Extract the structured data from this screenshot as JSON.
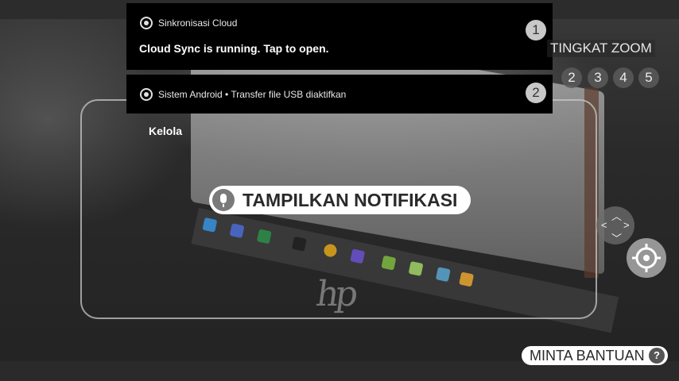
{
  "notifications": [
    {
      "app": "Sinkronisasi Cloud",
      "text": "Cloud Sync is running. Tap to open.",
      "badge": "1"
    },
    {
      "app": "Sistem Android • Transfer file USB diaktifkan",
      "badge": "2"
    }
  ],
  "manage_label": "Kelola",
  "zoom": {
    "label": "TINGKAT ZOOM",
    "levels": [
      "2",
      "3",
      "4",
      "5"
    ]
  },
  "voice_pill": {
    "label": "TAMPILKAN NOTIFIKASI",
    "icon": "mic-icon"
  },
  "help": {
    "label": "MINTA BANTUAN",
    "icon_text": "?"
  },
  "colors": {
    "notification_bg": "#000000",
    "pill_bg": "#ffffff"
  }
}
